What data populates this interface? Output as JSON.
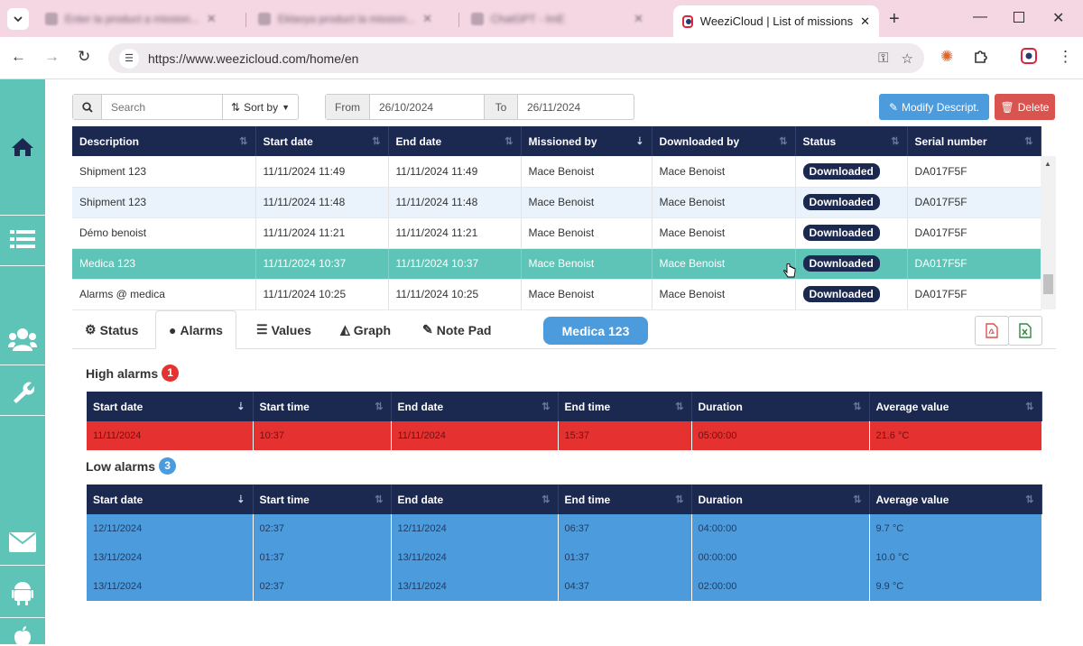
{
  "browser": {
    "bg_tabs": [
      {
        "title": "Enter la product a mission..."
      },
      {
        "title": "Eklavya product la mission..."
      },
      {
        "title": "ChatGPT - ImE"
      }
    ],
    "active_tab_title": "WeeziCloud | List of missions",
    "url": "https://www.weezicloud.com/home/en"
  },
  "toolbar": {
    "search_placeholder": "Search",
    "sort_label": "Sort by",
    "from_label": "From",
    "from_value": "26/10/2024",
    "to_label": "To",
    "to_value": "26/11/2024",
    "modify_label": "Modify Descript.",
    "delete_label": "Delete"
  },
  "missions": {
    "columns": [
      "Description",
      "Start date",
      "End date",
      "Missioned by",
      "Downloaded by",
      "Status",
      "Serial number"
    ],
    "rows": [
      {
        "description": "Shipment 123",
        "start": "11/11/2024 11:49",
        "end": "11/11/2024 11:49",
        "missioned_by": "Mace Benoist",
        "downloaded_by": "Mace Benoist",
        "status": "Downloaded",
        "serial": "DA017F5F"
      },
      {
        "description": "Shipment 123",
        "start": "11/11/2024 11:48",
        "end": "11/11/2024 11:48",
        "missioned_by": "Mace Benoist",
        "downloaded_by": "Mace Benoist",
        "status": "Downloaded",
        "serial": "DA017F5F"
      },
      {
        "description": "Démo benoist",
        "start": "11/11/2024 11:21",
        "end": "11/11/2024 11:21",
        "missioned_by": "Mace Benoist",
        "downloaded_by": "Mace Benoist",
        "status": "Downloaded",
        "serial": "DA017F5F"
      },
      {
        "description": "Medica 123",
        "start": "11/11/2024 10:37",
        "end": "11/11/2024 10:37",
        "missioned_by": "Mace Benoist",
        "downloaded_by": "Mace Benoist",
        "status": "Downloaded",
        "serial": "DA017F5F"
      },
      {
        "description": "Alarms @ medica",
        "start": "11/11/2024 10:25",
        "end": "11/11/2024 10:25",
        "missioned_by": "Mace Benoist",
        "downloaded_by": "Mace Benoist",
        "status": "Downloaded",
        "serial": "DA017F5F"
      }
    ]
  },
  "detail_tabs": [
    {
      "label": "Status",
      "icon": "gears-icon"
    },
    {
      "label": "Alarms",
      "icon": "bomb-icon"
    },
    {
      "label": "Values",
      "icon": "list-icon"
    },
    {
      "label": "Graph",
      "icon": "area-chart-icon"
    },
    {
      "label": "Note Pad",
      "icon": "edit-icon"
    }
  ],
  "selected_mission": "Medica 123",
  "high_alarms": {
    "title": "High alarms",
    "count": "1",
    "color": "#e5312f",
    "columns": [
      "Start date",
      "Start time",
      "End date",
      "End time",
      "Duration",
      "Average value"
    ],
    "rows": [
      [
        "11/11/2024",
        "10:37",
        "11/11/2024",
        "15:37",
        "05:00:00",
        "21.6 °C"
      ]
    ]
  },
  "low_alarms": {
    "title": "Low alarms",
    "count": "3",
    "color": "#4c9bdc",
    "columns": [
      "Start date",
      "Start time",
      "End date",
      "End time",
      "Duration",
      "Average value"
    ],
    "rows": [
      [
        "12/11/2024",
        "02:37",
        "12/11/2024",
        "06:37",
        "04:00:00",
        "9.7 °C"
      ],
      [
        "13/11/2024",
        "01:37",
        "13/11/2024",
        "01:37",
        "00:00:00",
        "10.0 °C"
      ],
      [
        "13/11/2024",
        "02:37",
        "13/11/2024",
        "04:37",
        "02:00:00",
        "9.9 °C"
      ]
    ]
  },
  "colors": {
    "sidebar": "#5ec4b8",
    "header": "#1b2850",
    "selected_row": "#5ec4b8",
    "primary": "#4c9bdc",
    "danger": "#d9534f"
  }
}
